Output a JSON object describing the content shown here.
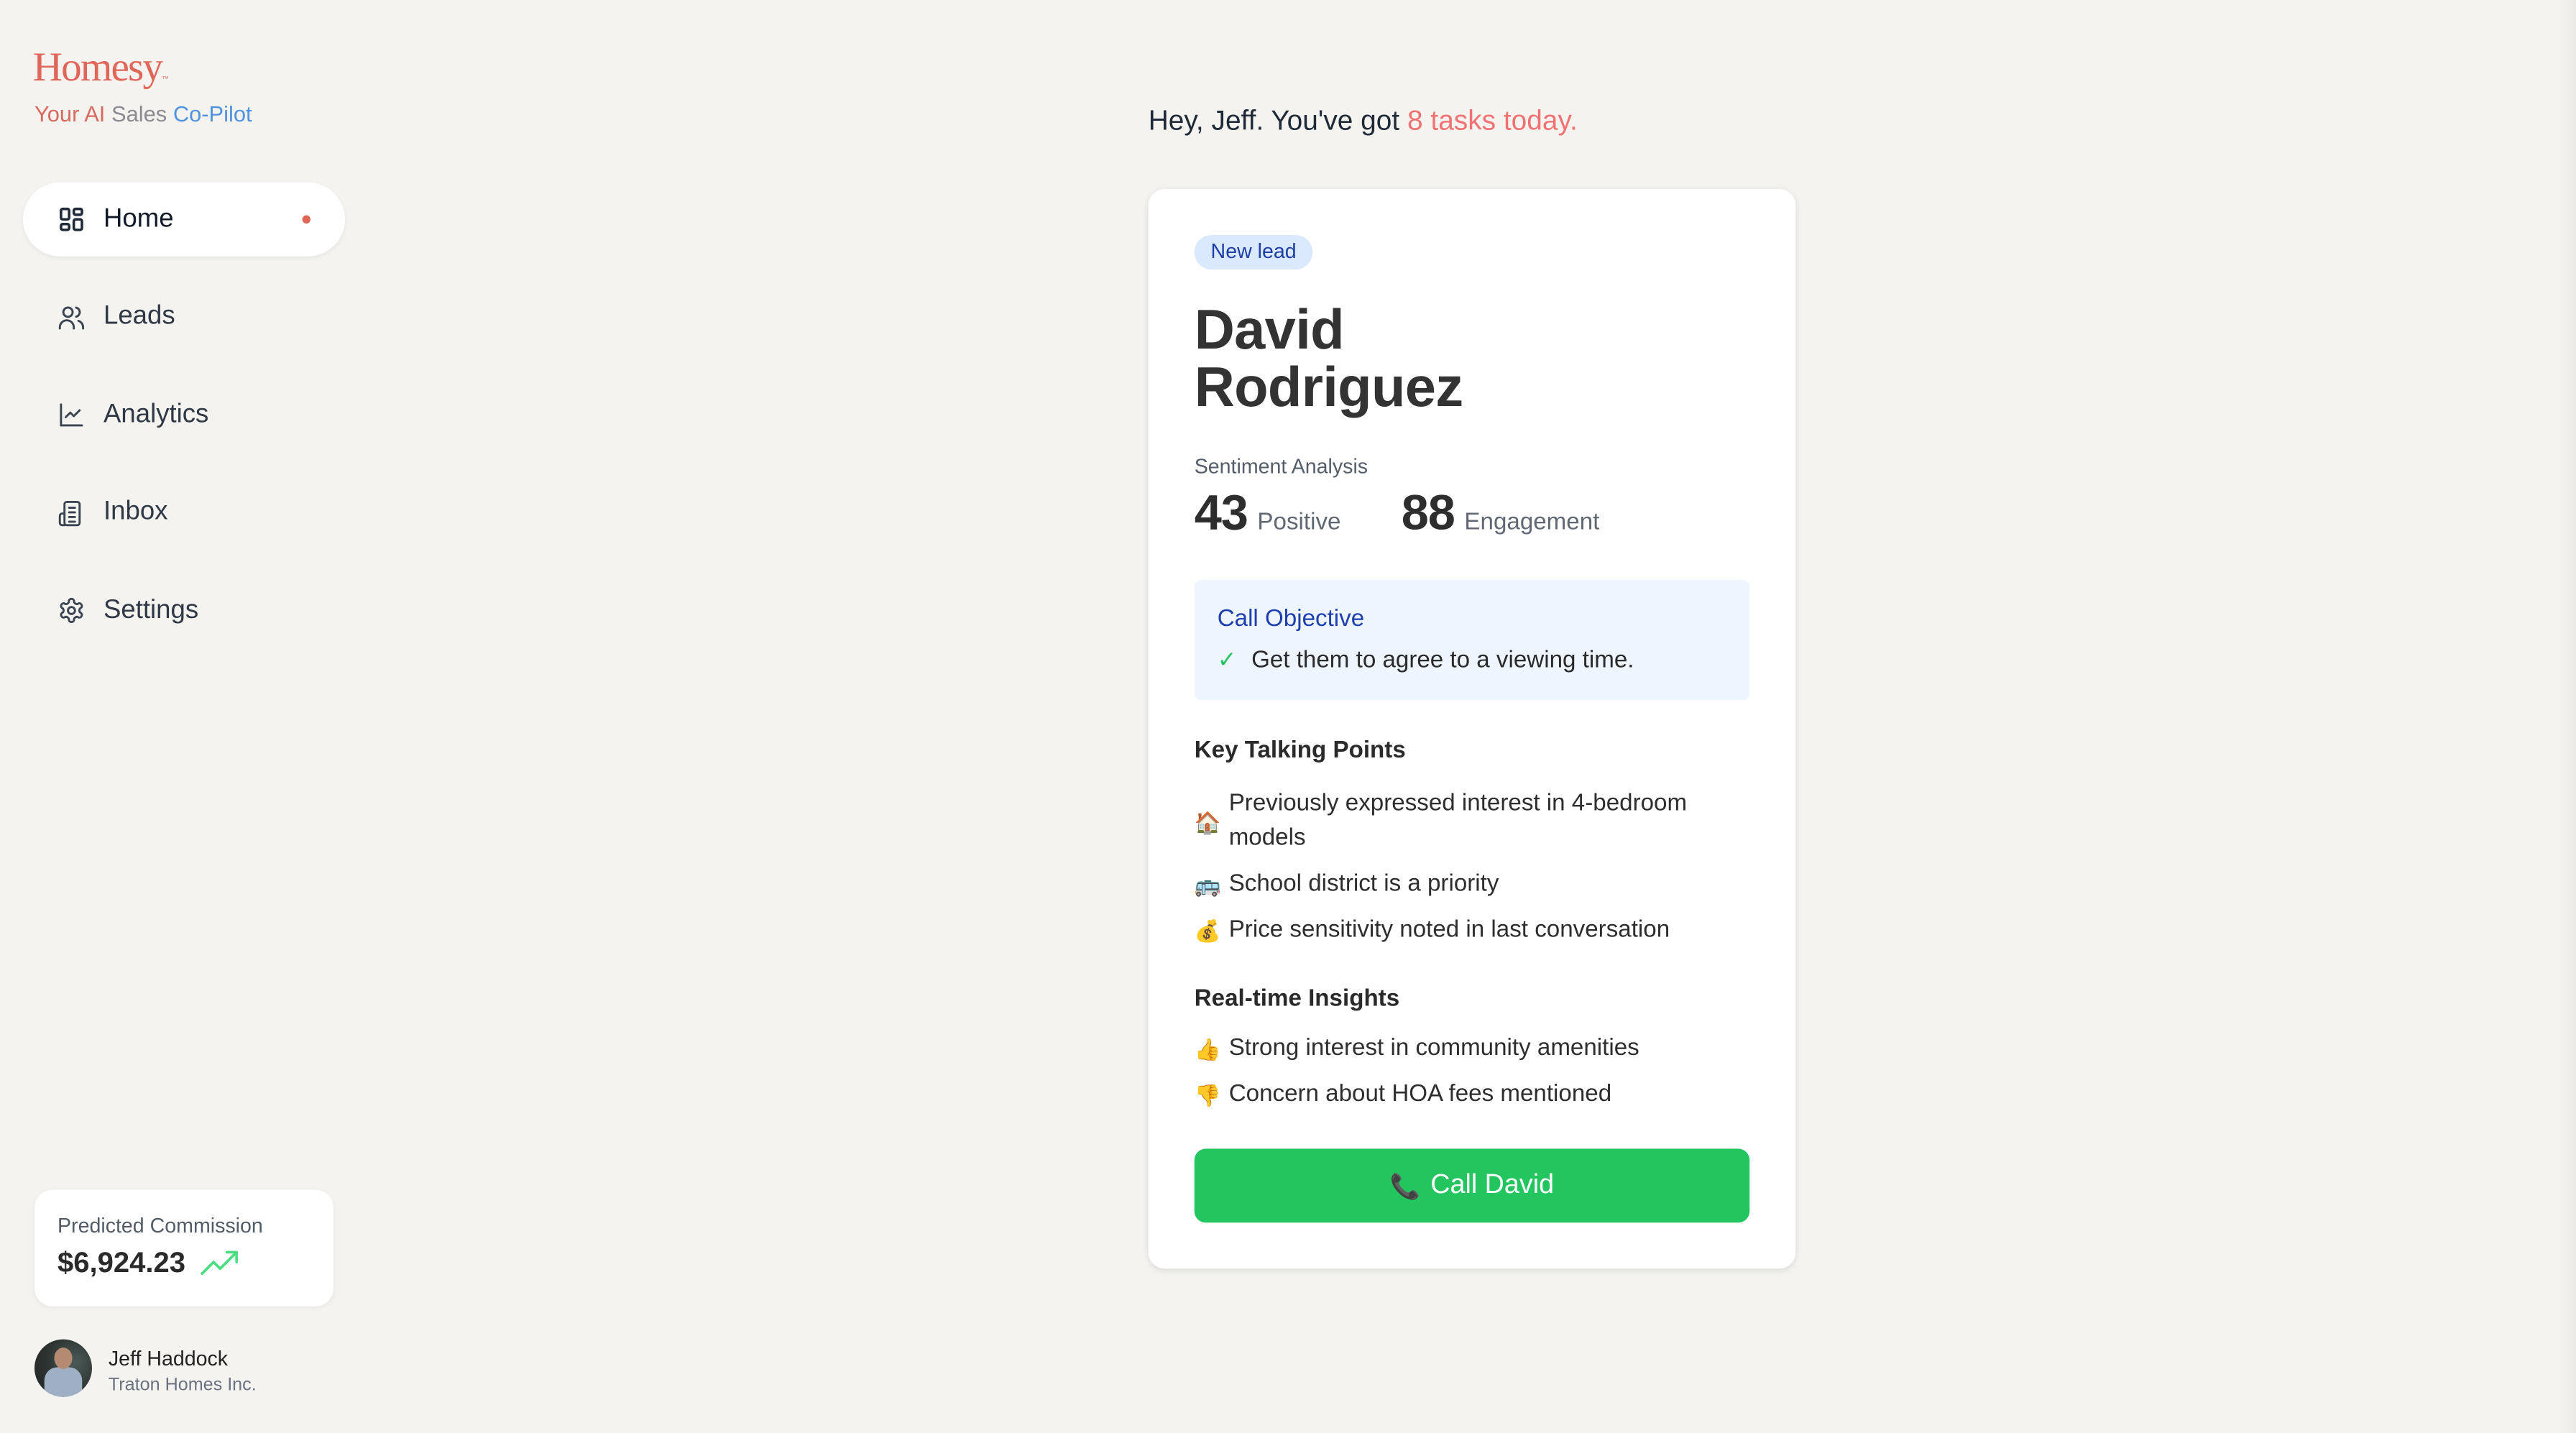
{
  "brand": {
    "logo_text": "Homesy",
    "trademark": "™",
    "tagline_parts": [
      "Your AI",
      "Sales",
      "Co-Pilot"
    ]
  },
  "sidebar": {
    "items": [
      {
        "label": "Home",
        "icon": "grid-icon",
        "active": true,
        "notification_dot": true
      },
      {
        "label": "Leads",
        "icon": "users-icon",
        "active": false
      },
      {
        "label": "Analytics",
        "icon": "line-chart-icon",
        "active": false
      },
      {
        "label": "Inbox",
        "icon": "inbox-icon",
        "active": false
      },
      {
        "label": "Settings",
        "icon": "gear-icon",
        "active": false
      }
    ],
    "commission": {
      "label": "Predicted Commission",
      "value": "$6,924.23",
      "trend_icon": "trending-up-icon"
    },
    "user": {
      "name": "Jeff Haddock",
      "company": "Traton Homes Inc."
    }
  },
  "greeting": {
    "prefix": "Hey, Jeff. You've got ",
    "highlight": "8 tasks today."
  },
  "lead_card": {
    "badge": "New lead",
    "first_name": "David",
    "last_name": "Rodriguez",
    "sentiment": {
      "label": "Sentiment Analysis",
      "positive_value": "43",
      "positive_label": "Positive",
      "engagement_value": "88",
      "engagement_label": "Engagement"
    },
    "objective": {
      "title": "Call Objective",
      "check": "✓",
      "text": "Get them to agree to a viewing time."
    },
    "talking_points": {
      "title": "Key Talking Points",
      "items": [
        {
          "emoji": "🏠",
          "text": "Previously expressed interest in 4-bedroom models"
        },
        {
          "emoji": "🚌",
          "text": "School district is a priority"
        },
        {
          "emoji": "💰",
          "text": "Price sensitivity noted in last conversation"
        }
      ]
    },
    "insights": {
      "title": "Real-time Insights",
      "items": [
        {
          "emoji": "👍",
          "text": "Strong interest in community amenities"
        },
        {
          "emoji": "👎",
          "text": "Concern about HOA fees mentioned"
        }
      ]
    },
    "call_button": {
      "icon": "📞",
      "label": "Call David"
    }
  },
  "colors": {
    "background": "#f4f3f0",
    "brand": "#e0665a",
    "accent_red": "#f07272",
    "call_green": "#22c55e",
    "badge_bg": "#dbe9fe",
    "badge_text": "#1e3fa8",
    "objective_bg": "#eef5ff"
  }
}
